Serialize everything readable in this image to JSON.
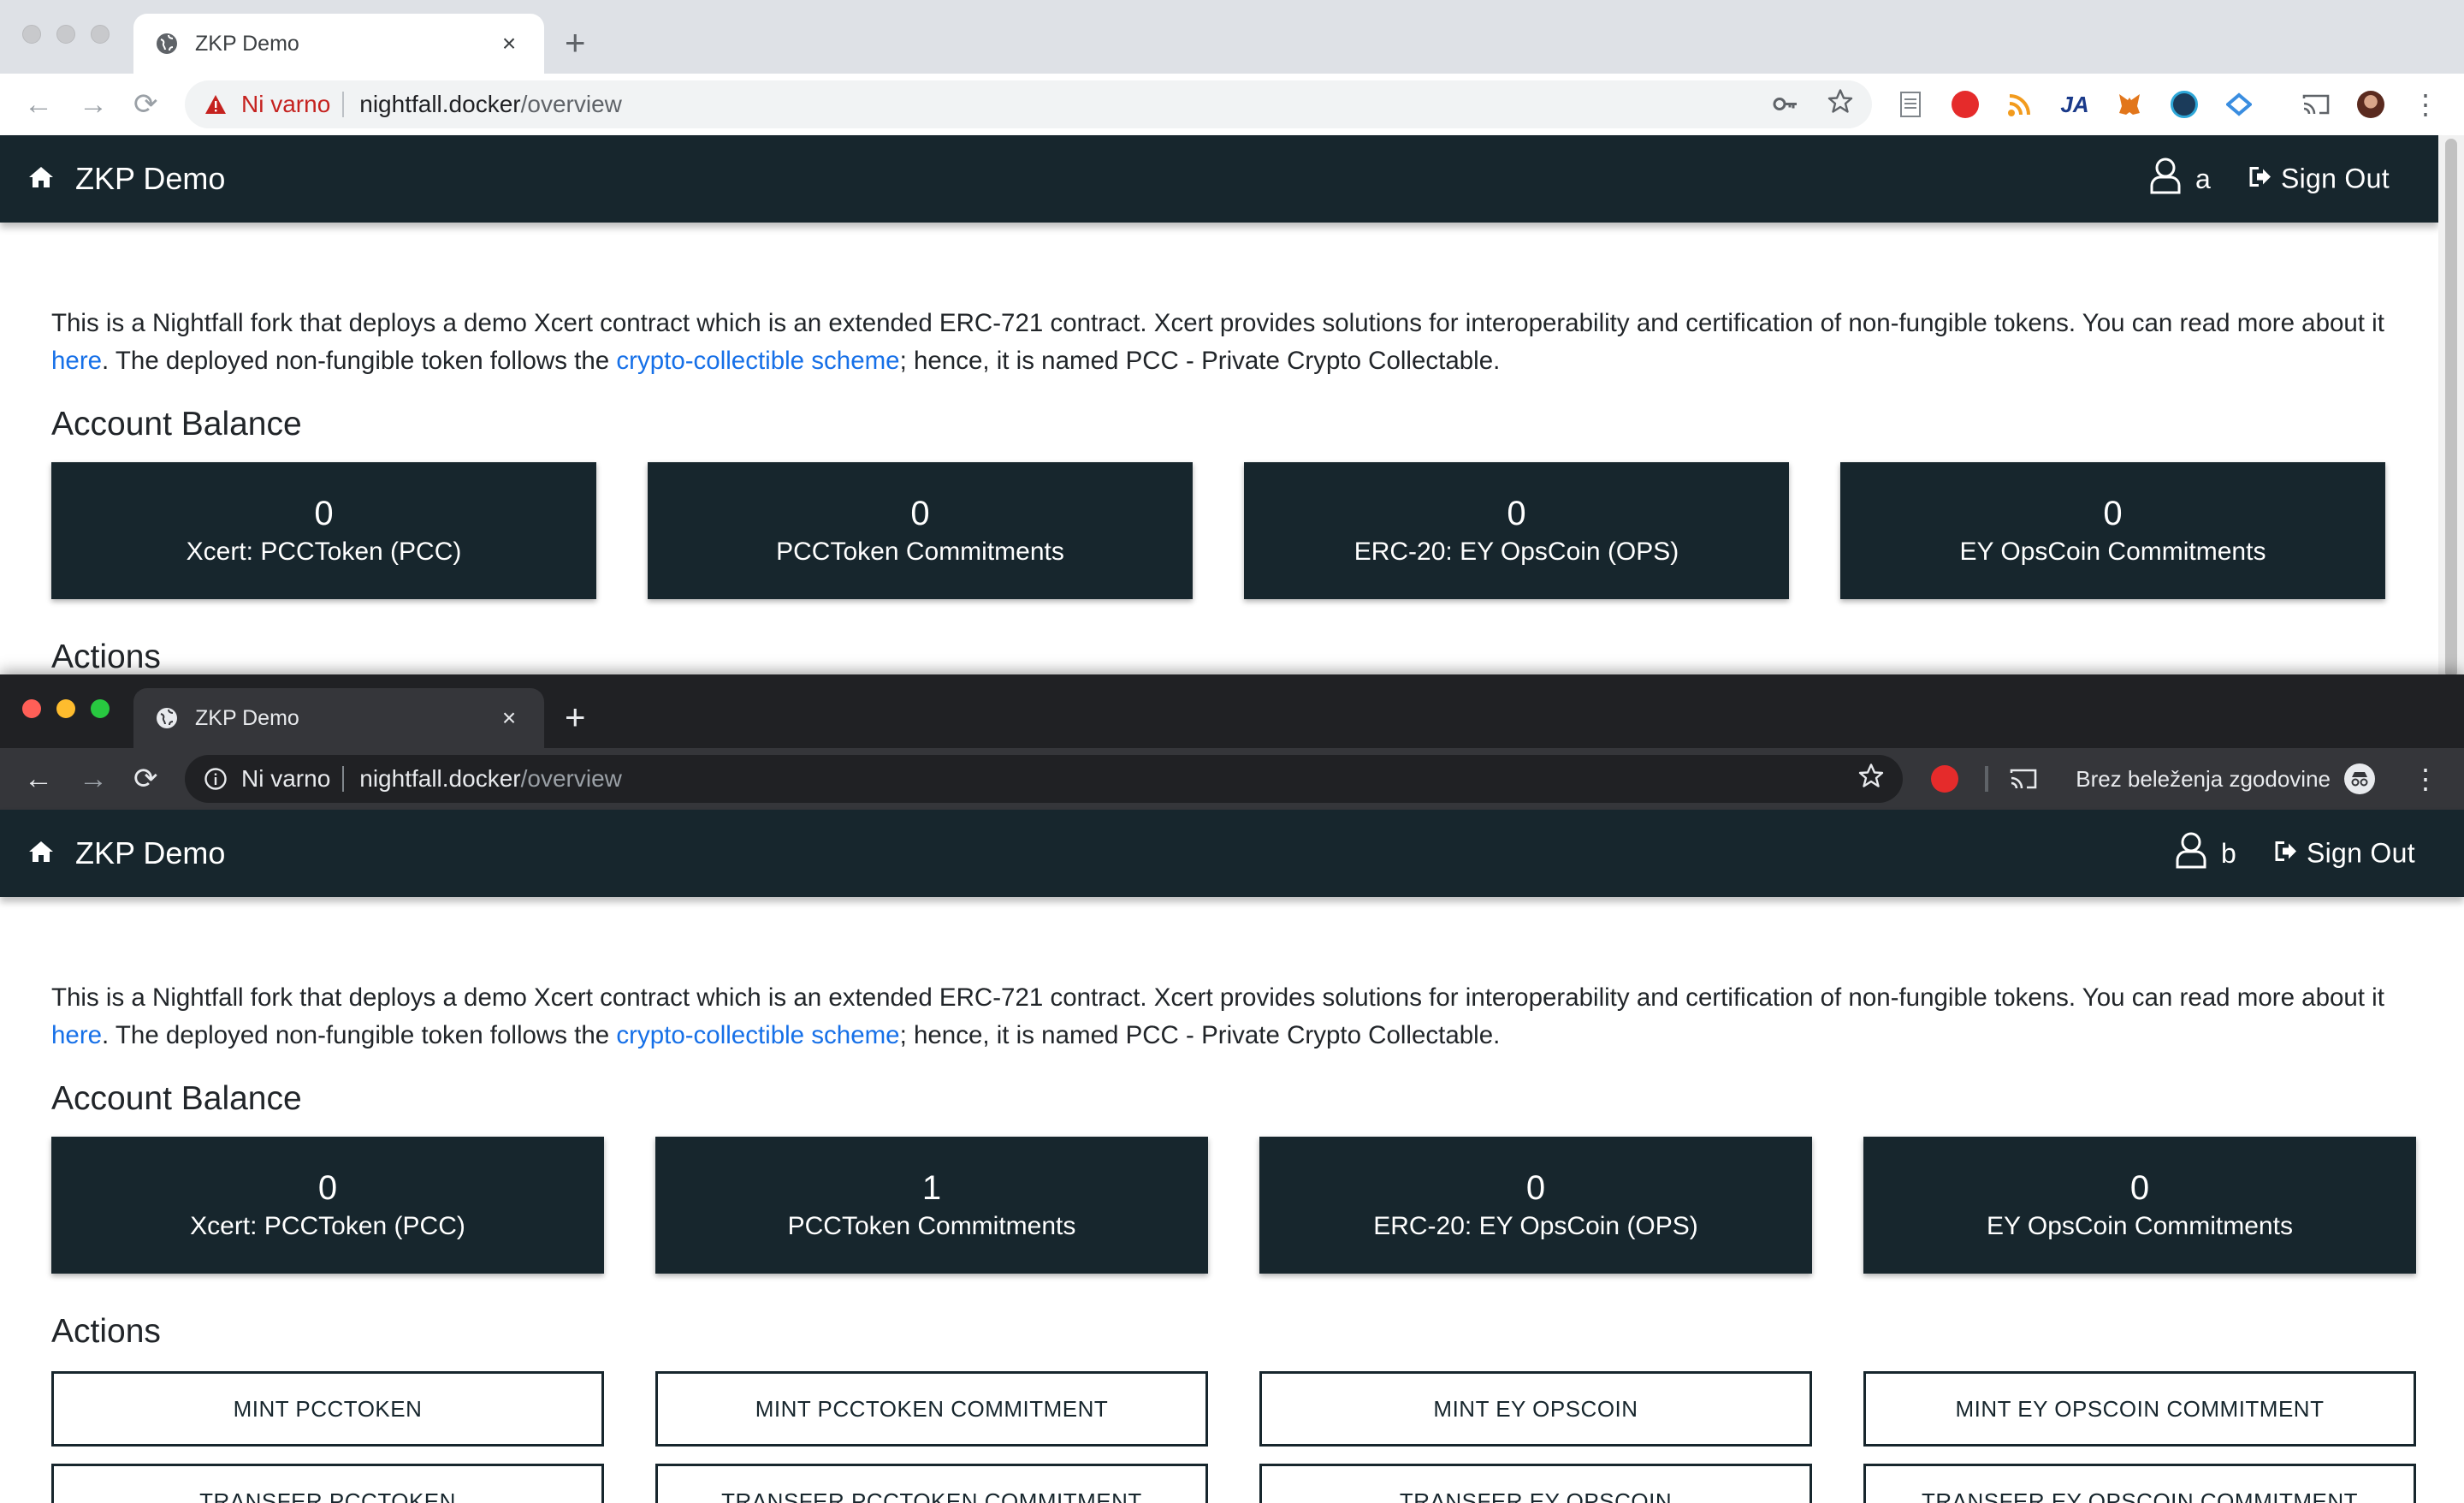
{
  "windows": [
    {
      "tab": {
        "title": "ZKP Demo",
        "close": "×"
      },
      "new_tab": "+",
      "nav": {
        "back": "←",
        "forward": "→",
        "reload": "⟳"
      },
      "omnibox": {
        "security_label": "Ni varno",
        "host": "nightfall.docker",
        "path": "/overview"
      },
      "incognito_label": "",
      "app": {
        "brand": "ZKP Demo",
        "user": "a",
        "sign_out": "Sign Out",
        "intro": {
          "p1": "This is a Nightfall fork that deploys a demo Xcert contract which is an extended ERC-721 contract. Xcert provides solutions for interoperability and certification of non-fungible tokens. You can read more about it ",
          "link1": "here",
          "p2": ". The deployed non-fungible token follows the ",
          "link2": "crypto-collectible scheme",
          "p3": "; hence, it is named PCC - Private Crypto Collectable."
        },
        "balance_heading": "Account Balance",
        "balances": [
          {
            "value": "0",
            "label": "Xcert: PCCToken (PCC)"
          },
          {
            "value": "0",
            "label": "PCCToken Commitments"
          },
          {
            "value": "0",
            "label": "ERC-20: EY OpsCoin (OPS)"
          },
          {
            "value": "0",
            "label": "EY OpsCoin Commitments"
          }
        ],
        "actions_heading": "Actions"
      }
    },
    {
      "tab": {
        "title": "ZKP Demo",
        "close": "×"
      },
      "new_tab": "+",
      "nav": {
        "back": "←",
        "forward": "→",
        "reload": "⟳"
      },
      "omnibox": {
        "security_label": "Ni varno",
        "host": "nightfall.docker",
        "path": "/overview"
      },
      "incognito_label": "Brez beleženja zgodovine",
      "app": {
        "brand": "ZKP Demo",
        "user": "b",
        "sign_out": "Sign Out",
        "intro": {
          "p1": "This is a Nightfall fork that deploys a demo Xcert contract which is an extended ERC-721 contract. Xcert provides solutions for interoperability and certification of non-fungible tokens. You can read more about it ",
          "link1": "here",
          "p2": ". The deployed non-fungible token follows the ",
          "link2": "crypto-collectible scheme",
          "p3": "; hence, it is named PCC - Private Crypto Collectable."
        },
        "balance_heading": "Account Balance",
        "balances": [
          {
            "value": "0",
            "label": "Xcert: PCCToken (PCC)"
          },
          {
            "value": "1",
            "label": "PCCToken Commitments"
          },
          {
            "value": "0",
            "label": "ERC-20: EY OpsCoin (OPS)"
          },
          {
            "value": "0",
            "label": "EY OpsCoin Commitments"
          }
        ],
        "actions_heading": "Actions",
        "actions": [
          "MINT PCCTOKEN",
          "MINT PCCTOKEN COMMITMENT",
          "MINT EY OPSCOIN",
          "MINT EY OPSCOIN COMMITMENT",
          "TRANSFER PCCTOKEN",
          "TRANSFER PCCTOKEN COMMITMENT",
          "TRANSFER EY OPSCOIN",
          "TRANSFER EY OPSCOIN COMMITMENT"
        ]
      }
    }
  ],
  "colors": {
    "navbar": "#17262d",
    "link": "#1670e8",
    "insecure": "#c5221f"
  }
}
